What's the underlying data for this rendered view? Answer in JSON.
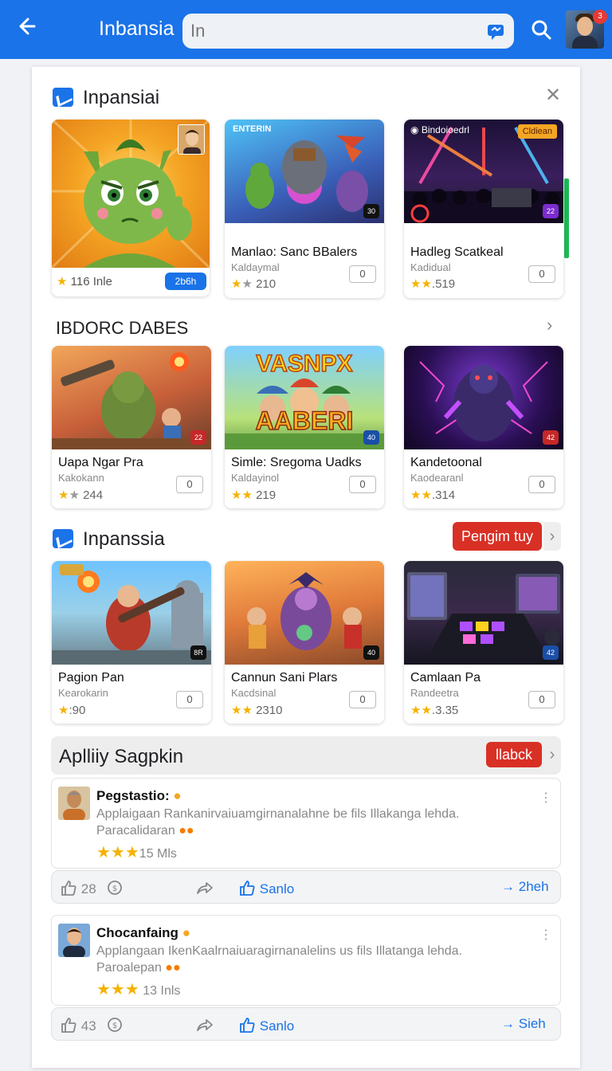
{
  "header": {
    "back_icon": "arrow-left-icon",
    "title": "Inbansia",
    "search_value": "In",
    "search_placeholder": "",
    "notification_count": "3"
  },
  "featured": {
    "title": "Inpansiai",
    "featured_card": {
      "rating": "116 Inle",
      "pill": "2b6h"
    },
    "cards": [
      {
        "brand": "ENTERIN",
        "title": "Manlao: Sanc BBalers",
        "sub": "Kaldaymal",
        "rating": "210",
        "count": "0",
        "badge": "30"
      },
      {
        "brand": "Bindoioedrl",
        "tag": "Cldiean",
        "title": "Hadleg Scatkeal",
        "sub": "Kadidual",
        "rating": ".519",
        "count": "0",
        "badge": "22"
      }
    ]
  },
  "section2": {
    "title": "IBDORC DABES",
    "cards": [
      {
        "title": "Uapa Ngar Pra",
        "sub": "Kakokann",
        "rating": "244",
        "count": "0",
        "badge": "22"
      },
      {
        "title": "Simle: Sregoma Uadks",
        "sub": "Kaldayinol",
        "rating": "219",
        "count": "0",
        "badge": "40",
        "art_text_1": "VASNPX",
        "art_text_2": "AABERI"
      },
      {
        "title": "Kandetoonal",
        "sub": "Kaodearanl",
        "rating": ".314",
        "count": "0",
        "badge": "42"
      }
    ]
  },
  "section3": {
    "title": "Inpanssia",
    "button": "Pengim tuy",
    "cards": [
      {
        "title": "Pagion Pan",
        "sub": "Kearokarin",
        "rating": ":90",
        "count": "0",
        "badge": "8R"
      },
      {
        "title": "Cannun Sani Plars",
        "sub": "Kacdsinal",
        "rating": "2310",
        "count": "0",
        "badge": "40"
      },
      {
        "title": "Camlaan Pa",
        "sub": "Randeetra",
        "rating": ".3.35",
        "count": "0",
        "badge": "42"
      }
    ]
  },
  "activity": {
    "title": "Aplliiy Sagpkin",
    "button": "llabck",
    "posts": [
      {
        "name": "Pegstastio:",
        "text1": "Applaigaan Rankanirvaiuamgirnanalahne be fils Illakanga lehda.",
        "text2": "Paracalidaran",
        "rating": "15 Mls",
        "likes": "28",
        "share": "Sanlo",
        "more": "2heh"
      },
      {
        "name": "Chocanfaing",
        "text1": "Applangaan IkenKaalrnaiuaragirnanalelins us fils Illatanga lehda.",
        "text2": "Paroalepan",
        "rating": "13 Inls",
        "likes": "43",
        "share": "Sanlo",
        "more": "Sieh"
      }
    ]
  },
  "colors": {
    "primary": "#1a73e8",
    "danger": "#d93025",
    "star": "#f5b301",
    "scroll": "#1db954"
  }
}
